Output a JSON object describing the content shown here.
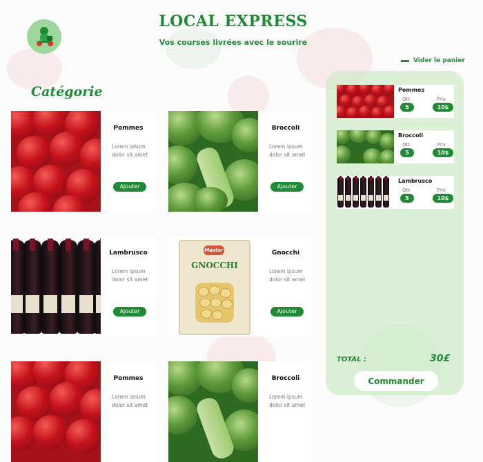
{
  "header": {
    "title": "LOCAL EXPRESS",
    "subtitle": "Vos courses livrées avec le sourire",
    "logo_icon": "delivery-scooter-icon"
  },
  "catalog": {
    "heading": "Catégorie",
    "add_label": "Ajouter",
    "products": [
      {
        "name": "Pommes",
        "description": "Lorem ipsum dolor sit amet",
        "image": "apples"
      },
      {
        "name": "Broccoli",
        "description": "Lorem ipsum dolor sit amet",
        "image": "broccoli"
      },
      {
        "name": "Lambrusco",
        "description": "Lorem ipsum dolor sit amet",
        "image": "wine-bottles"
      },
      {
        "name": "Gnocchi",
        "description": "Lorem ipsum dolor sit amet",
        "image": "gnocchi-bag",
        "package_brand": "Master",
        "package_text": "GNOCCHI"
      },
      {
        "name": "Pommes",
        "description": "Lorem ipsum dolor sit amet",
        "image": "apples"
      },
      {
        "name": "Broccoli",
        "description": "Lorem ipsum dolor sit amet",
        "image": "broccoli"
      }
    ]
  },
  "cart": {
    "clear_label": "Vider le panier",
    "qty_label": "Qtt",
    "price_label": "Prix",
    "items": [
      {
        "name": "Pommes",
        "qty": "5",
        "price": "10$"
      },
      {
        "name": "Broccoli",
        "qty": "5",
        "price": "10$"
      },
      {
        "name": "Lambrusco",
        "qty": "5",
        "price": "10$"
      }
    ],
    "total_label": "TOTAL :",
    "total_value": "30£",
    "order_label": "Commander"
  },
  "colors": {
    "brand": "#1f8b34",
    "cart_panel": "#c6eac0"
  }
}
